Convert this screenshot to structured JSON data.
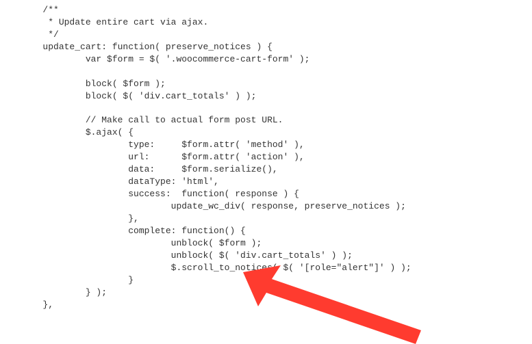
{
  "code": {
    "lines": [
      "        /**",
      "         * Update entire cart via ajax.",
      "         */",
      "        update_cart: function( preserve_notices ) {",
      "                var $form = $( '.woocommerce-cart-form' );",
      "",
      "                block( $form );",
      "                block( $( 'div.cart_totals' ) );",
      "",
      "                // Make call to actual form post URL.",
      "                $.ajax( {",
      "                        type:     $form.attr( 'method' ),",
      "                        url:      $form.attr( 'action' ),",
      "                        data:     $form.serialize(),",
      "                        dataType: 'html',",
      "                        success:  function( response ) {",
      "                                update_wc_div( response, preserve_notices );",
      "                        },",
      "                        complete: function() {",
      "                                unblock( $form );",
      "                                unblock( $( 'div.cart_totals' ) );",
      "                                $.scroll_to_notices( $( '[role=\"alert\"]' ) );",
      "                        }",
      "                } );",
      "        },"
    ]
  },
  "annotation": {
    "arrow_color": "#ff3b2f"
  }
}
